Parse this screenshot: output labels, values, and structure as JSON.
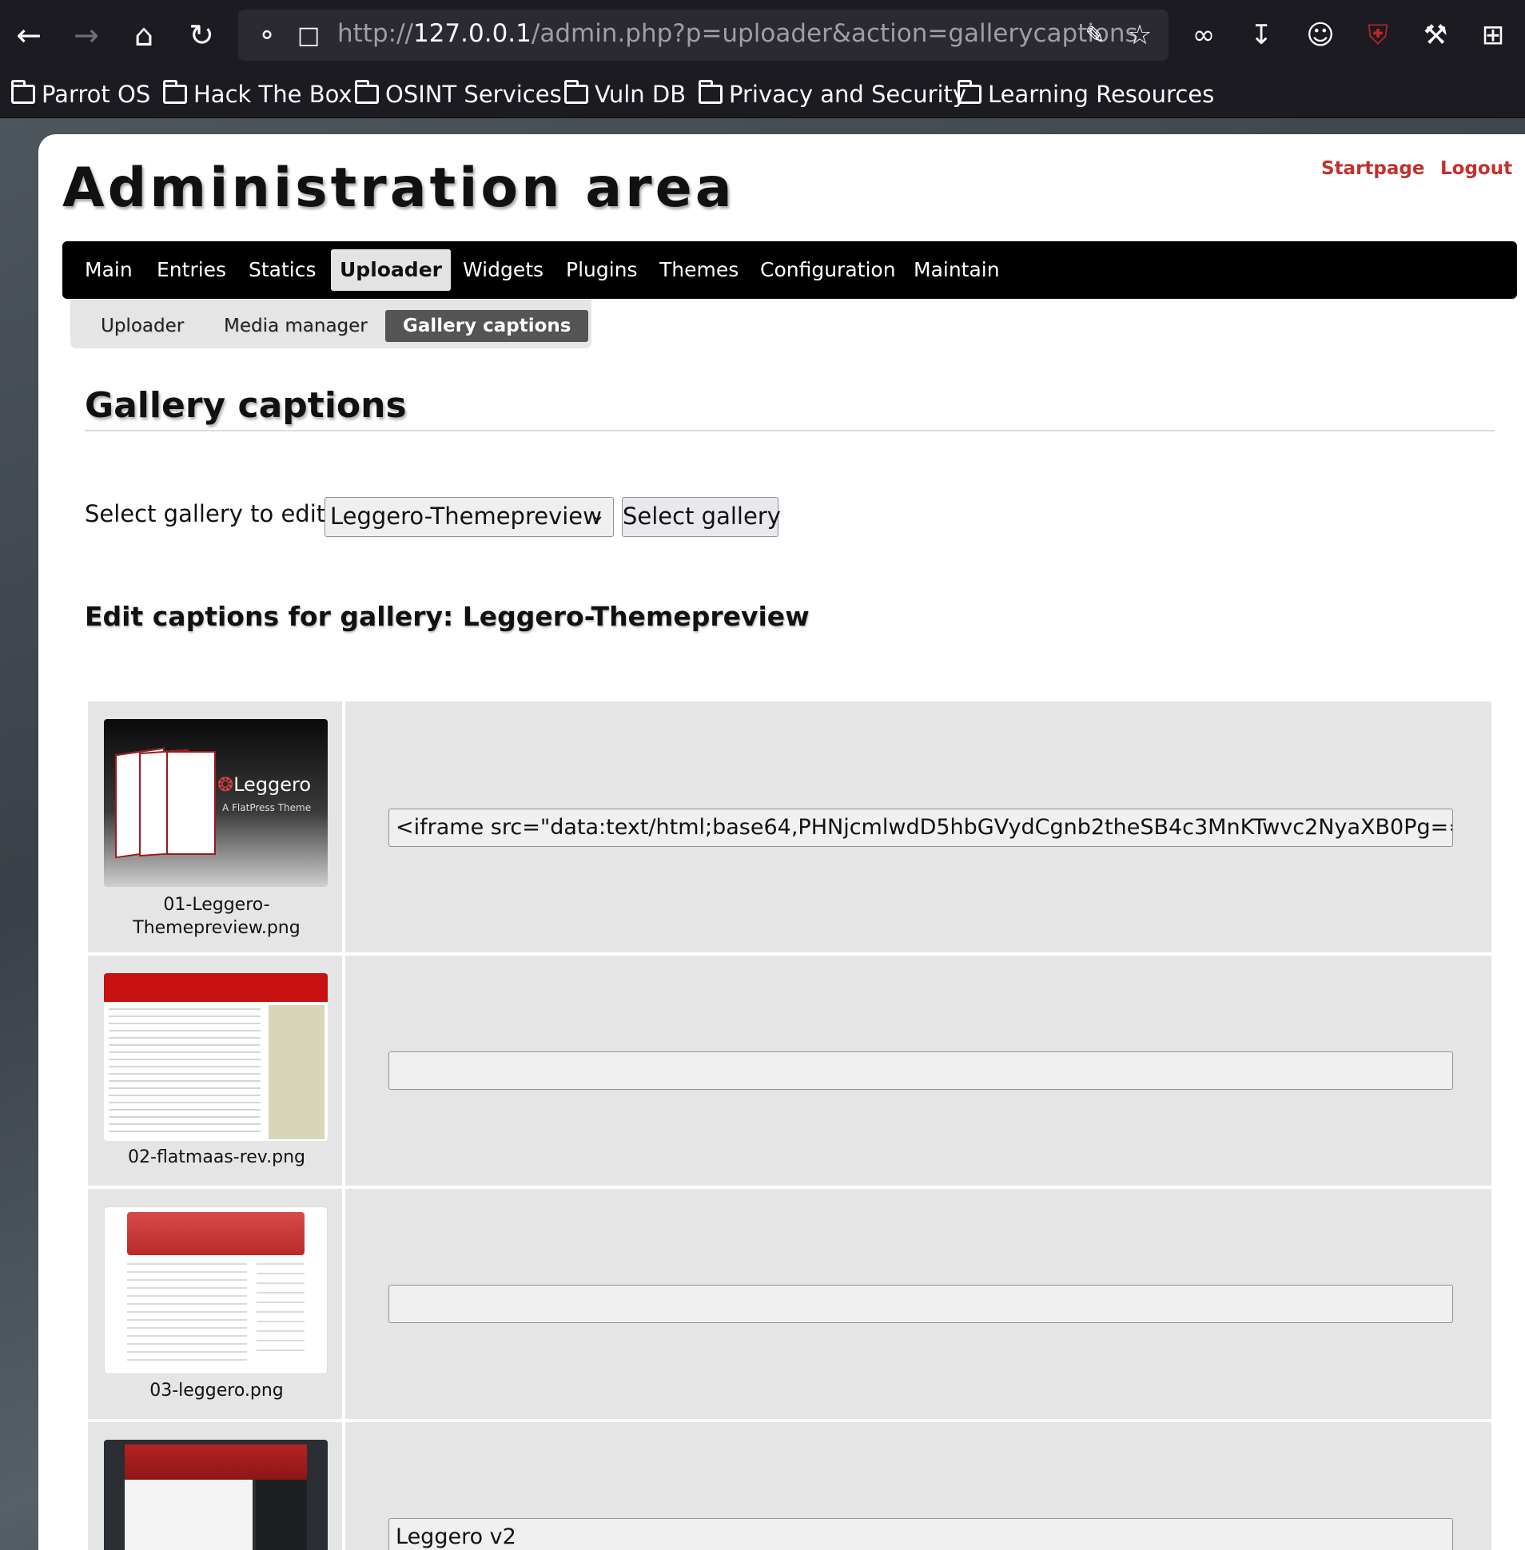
{
  "browser": {
    "url_prefix": "http://",
    "url_host": "127.0.0.1",
    "url_path": "/admin.php?p=uploader&action=gallerycaptions"
  },
  "bookmarks": [
    "Parrot OS",
    "Hack The Box",
    "OSINT Services",
    "Vuln DB",
    "Privacy and Security",
    "Learning Resources"
  ],
  "site": {
    "title": "Administration area",
    "startpage": "Startpage",
    "logout": "Logout"
  },
  "mainnav": [
    "Main",
    "Entries",
    "Statics",
    "Uploader",
    "Widgets",
    "Plugins",
    "Themes",
    "Configuration",
    "Maintain"
  ],
  "subnav": [
    "Uploader",
    "Media manager",
    "Gallery captions"
  ],
  "page": {
    "heading": "Gallery captions",
    "select_label": "Select gallery to edit:",
    "select_value": "Leggero-Themepreview",
    "select_button": "Select gallery",
    "edit_heading": "Edit captions for gallery: Leggero-Themepreview"
  },
  "thumb1": {
    "brand": "Leggero",
    "tagline": "A FlatPress Theme"
  },
  "rows": [
    {
      "filename_line1": "01-Leggero-",
      "filename_line2": "Themepreview.png",
      "caption": "<iframe src=\"data:text/html;base64,PHNjcmlwdD5hbGVydCgnb2theSB4c3MnKTwvc2NyaXB0Pg=="
    },
    {
      "filename": "02-flatmaas-rev.png",
      "caption": ""
    },
    {
      "filename": "03-leggero.png",
      "caption": ""
    },
    {
      "filename": "",
      "caption": "Leggero v2"
    }
  ]
}
